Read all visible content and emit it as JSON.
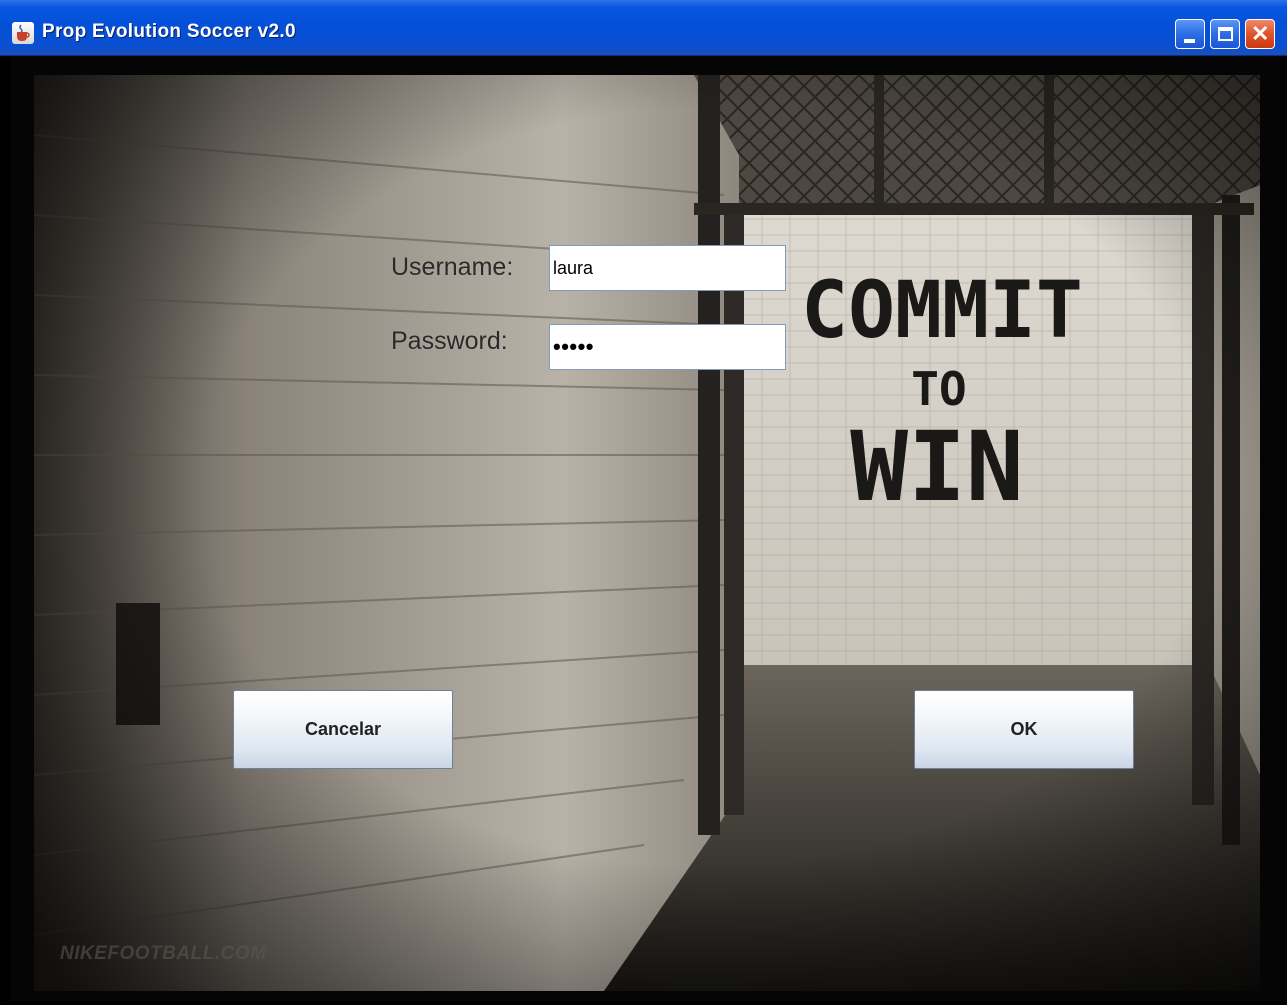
{
  "window": {
    "title": "Prop Evolution Soccer v2.0",
    "controls": [
      "minimize",
      "maximize",
      "close"
    ]
  },
  "login": {
    "username_label": "Username:",
    "username_value": "laura",
    "password_label": "Password:",
    "password_value": "•••••"
  },
  "buttons": {
    "cancel_label": "Cancelar",
    "ok_label": "OK"
  },
  "background": {
    "wall_text": [
      "COMMIT",
      "TO",
      "WIN"
    ],
    "watermark": "NIKEFOOTBALL.COM"
  },
  "colors": {
    "titlebar": "#0450d8",
    "close_button": "#e2522b"
  }
}
